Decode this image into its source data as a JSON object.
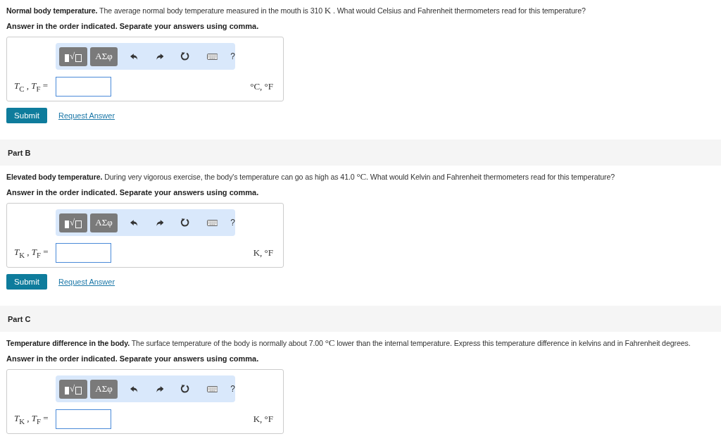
{
  "parts": [
    {
      "question": [
        {
          "kind": "lead",
          "text": "Normal body temperature."
        },
        {
          "kind": "plain",
          "text": " The average normal body temperature measured in the mouth is 310 "
        },
        {
          "kind": "math",
          "text": "K"
        },
        {
          "kind": "plain",
          "text": " . What would Celsius and Fahrenheit thermometers read for this temperature?"
        }
      ],
      "instruction": "Answer in the order indicated. Separate your answers using comma.",
      "toolbar": {
        "template": "√",
        "symbols": "ΑΣφ",
        "help": "?"
      },
      "label": "*T*$_{C}$ , *T*$_{F}$ =",
      "units": "°C, °F",
      "actions": {
        "submit": "Submit",
        "request": "Request Answer"
      }
    },
    {
      "header": "Part B",
      "question": [
        {
          "kind": "lead",
          "text": "Elevated body temperature."
        },
        {
          "kind": "plain",
          "text": " During very vigorous exercise, the body's temperature can go as high as 41.0 "
        },
        {
          "kind": "math",
          "text": "°C"
        },
        {
          "kind": "plain",
          "text": ". What would Kelvin and Fahrenheit thermometers read for this temperature?"
        }
      ],
      "instruction": "Answer in the order indicated. Separate your answers using comma.",
      "toolbar": {
        "template": "√",
        "symbols": "ΑΣφ",
        "help": "?"
      },
      "label": "*T*$_{K}$ , *T*$_{F}$ =",
      "units": "K, °F",
      "actions": {
        "submit": "Submit",
        "request": "Request Answer"
      }
    },
    {
      "header": "Part C",
      "question": [
        {
          "kind": "lead",
          "text": "Temperature difference in the body."
        },
        {
          "kind": "plain",
          "text": " The surface temperature of the body is normally about 7.00 "
        },
        {
          "kind": "math",
          "text": "°C"
        },
        {
          "kind": "plain",
          "text": " lower than the internal temperature. Express this temperature difference in kelvins and in Fahrenheit degrees."
        }
      ],
      "instruction": "Answer in the order indicated. Separate your answers using comma.",
      "toolbar": {
        "template": "√",
        "symbols": "ΑΣφ",
        "help": "?"
      },
      "label": "*T*$_{K}$ , *T*$_{F}$ =",
      "units": "K, °F"
    }
  ]
}
